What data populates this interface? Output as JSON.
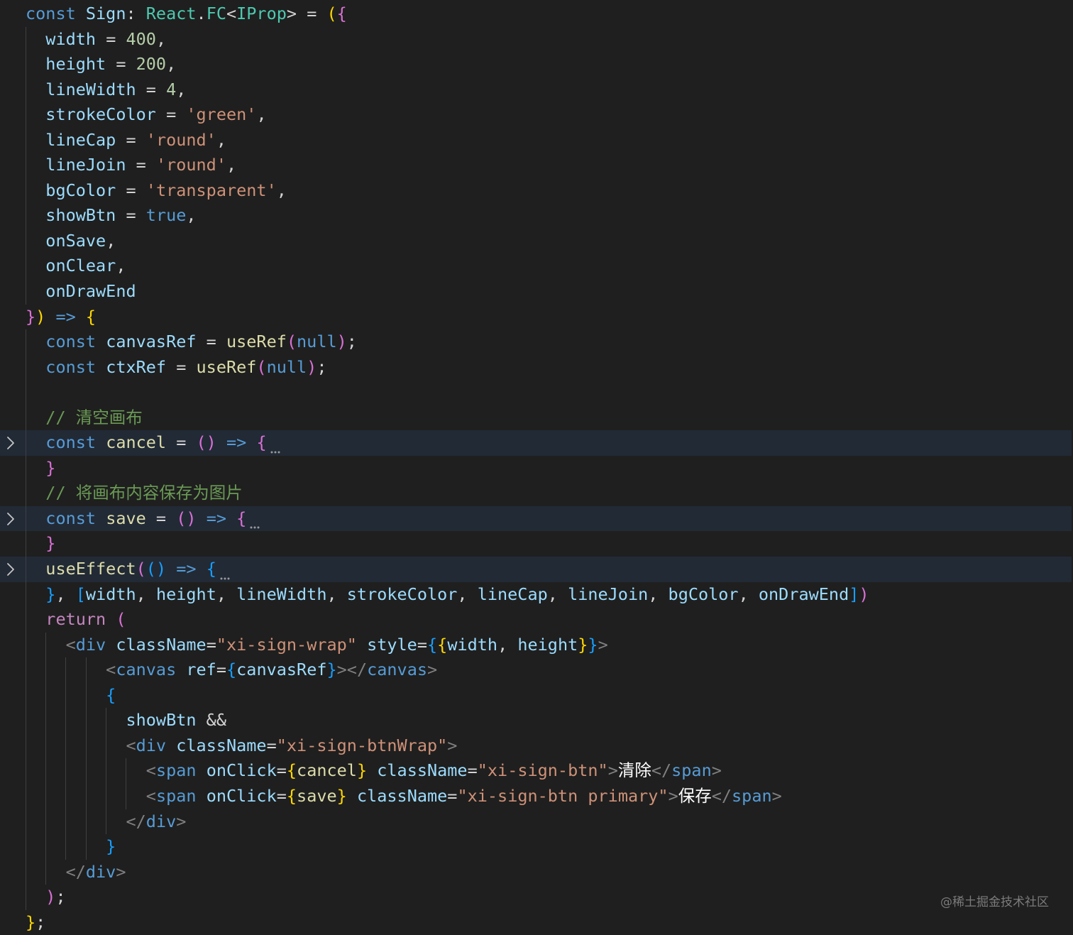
{
  "editor": {
    "lines": [
      {
        "tokens": [
          {
            "t": "const ",
            "c": "k"
          },
          {
            "t": "Sign",
            "c": "v"
          },
          {
            "t": ": ",
            "c": "op"
          },
          {
            "t": "React",
            "c": "t"
          },
          {
            "t": ".",
            "c": "op"
          },
          {
            "t": "FC",
            "c": "t"
          },
          {
            "t": "<",
            "c": "op"
          },
          {
            "t": "IProp",
            "c": "t"
          },
          {
            "t": ">",
            "c": "op"
          },
          {
            "t": " = ",
            "c": "op"
          },
          {
            "t": "(",
            "c": "p1"
          },
          {
            "t": "{",
            "c": "p2"
          }
        ]
      },
      {
        "guides": [
          36
        ],
        "tokens": [
          {
            "t": "  width",
            "c": "v"
          },
          {
            "t": " = ",
            "c": "op"
          },
          {
            "t": "400",
            "c": "n"
          },
          {
            "t": ",",
            "c": "op"
          }
        ]
      },
      {
        "guides": [
          36
        ],
        "tokens": [
          {
            "t": "  height",
            "c": "v"
          },
          {
            "t": " = ",
            "c": "op"
          },
          {
            "t": "200",
            "c": "n"
          },
          {
            "t": ",",
            "c": "op"
          }
        ]
      },
      {
        "guides": [
          36
        ],
        "tokens": [
          {
            "t": "  lineWidth",
            "c": "v"
          },
          {
            "t": " = ",
            "c": "op"
          },
          {
            "t": "4",
            "c": "n"
          },
          {
            "t": ",",
            "c": "op"
          }
        ]
      },
      {
        "guides": [
          36
        ],
        "tokens": [
          {
            "t": "  strokeColor",
            "c": "v"
          },
          {
            "t": " = ",
            "c": "op"
          },
          {
            "t": "'green'",
            "c": "s"
          },
          {
            "t": ",",
            "c": "op"
          }
        ]
      },
      {
        "guides": [
          36
        ],
        "tokens": [
          {
            "t": "  lineCap",
            "c": "v"
          },
          {
            "t": " = ",
            "c": "op"
          },
          {
            "t": "'round'",
            "c": "s"
          },
          {
            "t": ",",
            "c": "op"
          }
        ]
      },
      {
        "guides": [
          36
        ],
        "tokens": [
          {
            "t": "  lineJoin",
            "c": "v"
          },
          {
            "t": " = ",
            "c": "op"
          },
          {
            "t": "'round'",
            "c": "s"
          },
          {
            "t": ",",
            "c": "op"
          }
        ]
      },
      {
        "guides": [
          36
        ],
        "tokens": [
          {
            "t": "  bgColor",
            "c": "v"
          },
          {
            "t": " = ",
            "c": "op"
          },
          {
            "t": "'transparent'",
            "c": "s"
          },
          {
            "t": ",",
            "c": "op"
          }
        ]
      },
      {
        "guides": [
          36
        ],
        "tokens": [
          {
            "t": "  showBtn",
            "c": "v"
          },
          {
            "t": " = ",
            "c": "op"
          },
          {
            "t": "true",
            "c": "k"
          },
          {
            "t": ",",
            "c": "op"
          }
        ]
      },
      {
        "guides": [
          36
        ],
        "tokens": [
          {
            "t": "  onSave",
            "c": "v"
          },
          {
            "t": ",",
            "c": "op"
          }
        ]
      },
      {
        "guides": [
          36
        ],
        "tokens": [
          {
            "t": "  onClear",
            "c": "v"
          },
          {
            "t": ",",
            "c": "op"
          }
        ]
      },
      {
        "guides": [
          36
        ],
        "tokens": [
          {
            "t": "  onDrawEnd",
            "c": "v"
          }
        ]
      },
      {
        "tokens": [
          {
            "t": "}",
            "c": "p2"
          },
          {
            "t": ")",
            "c": "p1"
          },
          {
            "t": " ",
            "c": "op"
          },
          {
            "t": "=>",
            "c": "k"
          },
          {
            "t": " ",
            "c": "op"
          },
          {
            "t": "{",
            "c": "p1"
          }
        ]
      },
      {
        "guides": [
          36
        ],
        "tokens": [
          {
            "t": "  const ",
            "c": "k"
          },
          {
            "t": "canvasRef",
            "c": "v"
          },
          {
            "t": " = ",
            "c": "op"
          },
          {
            "t": "useRef",
            "c": "f"
          },
          {
            "t": "(",
            "c": "p2"
          },
          {
            "t": "null",
            "c": "k"
          },
          {
            "t": ")",
            "c": "p2"
          },
          {
            "t": ";",
            "c": "op"
          }
        ]
      },
      {
        "guides": [
          36
        ],
        "tokens": [
          {
            "t": "  const ",
            "c": "k"
          },
          {
            "t": "ctxRef",
            "c": "v"
          },
          {
            "t": " = ",
            "c": "op"
          },
          {
            "t": "useRef",
            "c": "f"
          },
          {
            "t": "(",
            "c": "p2"
          },
          {
            "t": "null",
            "c": "k"
          },
          {
            "t": ")",
            "c": "p2"
          },
          {
            "t": ";",
            "c": "op"
          }
        ]
      },
      {
        "guides": [
          36
        ],
        "tokens": []
      },
      {
        "guides": [
          36
        ],
        "tokens": [
          {
            "t": "  // ",
            "c": "c"
          },
          {
            "t": "清空画布",
            "c": "c cm-cjk"
          }
        ]
      },
      {
        "folded": true,
        "fold": true,
        "guides": [
          36
        ],
        "tokens": [
          {
            "t": "  const ",
            "c": "k"
          },
          {
            "t": "cancel",
            "c": "f"
          },
          {
            "t": " = ",
            "c": "op"
          },
          {
            "t": "()",
            "c": "p2"
          },
          {
            "t": " ",
            "c": "op"
          },
          {
            "t": "=>",
            "c": "k"
          },
          {
            "t": " ",
            "c": "op"
          },
          {
            "t": "{",
            "c": "p2"
          }
        ],
        "ellipsis": true
      },
      {
        "guides": [
          36
        ],
        "tokens": [
          {
            "t": "  }",
            "c": "p2"
          }
        ]
      },
      {
        "guides": [
          36
        ],
        "tokens": [
          {
            "t": "  // ",
            "c": "c"
          },
          {
            "t": "将画布内容保存为图片",
            "c": "c cm-cjk"
          }
        ]
      },
      {
        "folded": true,
        "fold": true,
        "guides": [
          36
        ],
        "tokens": [
          {
            "t": "  const ",
            "c": "k"
          },
          {
            "t": "save",
            "c": "f"
          },
          {
            "t": " = ",
            "c": "op"
          },
          {
            "t": "()",
            "c": "p2"
          },
          {
            "t": " ",
            "c": "op"
          },
          {
            "t": "=>",
            "c": "k"
          },
          {
            "t": " ",
            "c": "op"
          },
          {
            "t": "{",
            "c": "p2"
          }
        ],
        "ellipsis": true
      },
      {
        "guides": [
          36
        ],
        "tokens": [
          {
            "t": "  }",
            "c": "p2"
          }
        ]
      },
      {
        "folded": true,
        "fold": true,
        "guides": [
          36
        ],
        "tokens": [
          {
            "t": "  useEffect",
            "c": "f"
          },
          {
            "t": "(",
            "c": "p2"
          },
          {
            "t": "()",
            "c": "p3"
          },
          {
            "t": " ",
            "c": "op"
          },
          {
            "t": "=>",
            "c": "k"
          },
          {
            "t": " ",
            "c": "op"
          },
          {
            "t": "{",
            "c": "p3"
          }
        ],
        "ellipsis": true
      },
      {
        "guides": [
          36
        ],
        "tokens": [
          {
            "t": "  }",
            "c": "p3"
          },
          {
            "t": ", ",
            "c": "op"
          },
          {
            "t": "[",
            "c": "p3"
          },
          {
            "t": "width",
            "c": "v"
          },
          {
            "t": ", ",
            "c": "op"
          },
          {
            "t": "height",
            "c": "v"
          },
          {
            "t": ", ",
            "c": "op"
          },
          {
            "t": "lineWidth",
            "c": "v"
          },
          {
            "t": ", ",
            "c": "op"
          },
          {
            "t": "strokeColor",
            "c": "v"
          },
          {
            "t": ", ",
            "c": "op"
          },
          {
            "t": "lineCap",
            "c": "v"
          },
          {
            "t": ", ",
            "c": "op"
          },
          {
            "t": "lineJoin",
            "c": "v"
          },
          {
            "t": ", ",
            "c": "op"
          },
          {
            "t": "bgColor",
            "c": "v"
          },
          {
            "t": ", ",
            "c": "op"
          },
          {
            "t": "onDrawEnd",
            "c": "v"
          },
          {
            "t": "]",
            "c": "p3"
          },
          {
            "t": ")",
            "c": "p2"
          }
        ]
      },
      {
        "guides": [
          36
        ],
        "tokens": [
          {
            "t": "  return ",
            "c": "ret"
          },
          {
            "t": "(",
            "c": "p2"
          }
        ]
      },
      {
        "guides": [
          36,
          64
        ],
        "tokens": [
          {
            "t": "    <",
            "c": "br"
          },
          {
            "t": "div",
            "c": "tag"
          },
          {
            "t": " ",
            "c": "op"
          },
          {
            "t": "className",
            "c": "attr"
          },
          {
            "t": "=",
            "c": "op"
          },
          {
            "t": "\"xi-sign-wrap\"",
            "c": "s"
          },
          {
            "t": " ",
            "c": "op"
          },
          {
            "t": "style",
            "c": "attr"
          },
          {
            "t": "=",
            "c": "op"
          },
          {
            "t": "{",
            "c": "p3"
          },
          {
            "t": "{",
            "c": "p1"
          },
          {
            "t": "width",
            "c": "v"
          },
          {
            "t": ", ",
            "c": "op"
          },
          {
            "t": "height",
            "c": "v"
          },
          {
            "t": "}",
            "c": "p1"
          },
          {
            "t": "}",
            "c": "p3"
          },
          {
            "t": ">",
            "c": "br"
          }
        ]
      },
      {
        "guides": [
          36,
          64,
          92,
          121
        ],
        "tokens": [
          {
            "t": "        <",
            "c": "br"
          },
          {
            "t": "canvas",
            "c": "tag"
          },
          {
            "t": " ",
            "c": "op"
          },
          {
            "t": "ref",
            "c": "attr"
          },
          {
            "t": "=",
            "c": "op"
          },
          {
            "t": "{",
            "c": "p3"
          },
          {
            "t": "canvasRef",
            "c": "v"
          },
          {
            "t": "}",
            "c": "p3"
          },
          {
            "t": "></",
            "c": "br"
          },
          {
            "t": "canvas",
            "c": "tag"
          },
          {
            "t": ">",
            "c": "br"
          }
        ]
      },
      {
        "guides": [
          36,
          64,
          92,
          121
        ],
        "tokens": [
          {
            "t": "        {",
            "c": "p3"
          }
        ]
      },
      {
        "guides": [
          36,
          64,
          92,
          121,
          149
        ],
        "tokens": [
          {
            "t": "          showBtn",
            "c": "v"
          },
          {
            "t": " && ",
            "c": "op"
          }
        ]
      },
      {
        "guides": [
          36,
          64,
          92,
          121,
          149
        ],
        "tokens": [
          {
            "t": "          <",
            "c": "br"
          },
          {
            "t": "div",
            "c": "tag"
          },
          {
            "t": " ",
            "c": "op"
          },
          {
            "t": "className",
            "c": "attr"
          },
          {
            "t": "=",
            "c": "op"
          },
          {
            "t": "\"xi-sign-btnWrap\"",
            "c": "s"
          },
          {
            "t": ">",
            "c": "br"
          }
        ]
      },
      {
        "guides": [
          36,
          64,
          92,
          121,
          149,
          177
        ],
        "tokens": [
          {
            "t": "            <",
            "c": "br"
          },
          {
            "t": "span",
            "c": "tag"
          },
          {
            "t": " ",
            "c": "op"
          },
          {
            "t": "onClick",
            "c": "attr"
          },
          {
            "t": "=",
            "c": "op"
          },
          {
            "t": "{",
            "c": "p1"
          },
          {
            "t": "cancel",
            "c": "f"
          },
          {
            "t": "}",
            "c": "p1"
          },
          {
            "t": " ",
            "c": "op"
          },
          {
            "t": "className",
            "c": "attr"
          },
          {
            "t": "=",
            "c": "op"
          },
          {
            "t": "\"xi-sign-btn\"",
            "c": "s"
          },
          {
            "t": ">",
            "c": "br"
          },
          {
            "t": "清除",
            "c": "txt"
          },
          {
            "t": "</",
            "c": "br"
          },
          {
            "t": "span",
            "c": "tag"
          },
          {
            "t": ">",
            "c": "br"
          }
        ]
      },
      {
        "guides": [
          36,
          64,
          92,
          121,
          149,
          177
        ],
        "tokens": [
          {
            "t": "            <",
            "c": "br"
          },
          {
            "t": "span",
            "c": "tag"
          },
          {
            "t": " ",
            "c": "op"
          },
          {
            "t": "onClick",
            "c": "attr"
          },
          {
            "t": "=",
            "c": "op"
          },
          {
            "t": "{",
            "c": "p1"
          },
          {
            "t": "save",
            "c": "f"
          },
          {
            "t": "}",
            "c": "p1"
          },
          {
            "t": " ",
            "c": "op"
          },
          {
            "t": "className",
            "c": "attr"
          },
          {
            "t": "=",
            "c": "op"
          },
          {
            "t": "\"xi-sign-btn primary\"",
            "c": "s"
          },
          {
            "t": ">",
            "c": "br"
          },
          {
            "t": "保存",
            "c": "txt"
          },
          {
            "t": "</",
            "c": "br"
          },
          {
            "t": "span",
            "c": "tag"
          },
          {
            "t": ">",
            "c": "br"
          }
        ]
      },
      {
        "guides": [
          36,
          64,
          92,
          121,
          149
        ],
        "tokens": [
          {
            "t": "          </",
            "c": "br"
          },
          {
            "t": "div",
            "c": "tag"
          },
          {
            "t": ">",
            "c": "br"
          }
        ]
      },
      {
        "guides": [
          36,
          64,
          92,
          121
        ],
        "tokens": [
          {
            "t": "        }",
            "c": "p3"
          }
        ]
      },
      {
        "guides": [
          36,
          64
        ],
        "tokens": [
          {
            "t": "    </",
            "c": "br"
          },
          {
            "t": "div",
            "c": "tag"
          },
          {
            "t": ">",
            "c": "br"
          }
        ]
      },
      {
        "guides": [
          36
        ],
        "tokens": [
          {
            "t": "  )",
            "c": "p2"
          },
          {
            "t": ";",
            "c": "op"
          }
        ]
      },
      {
        "tokens": [
          {
            "t": "}",
            "c": "p1"
          },
          {
            "t": ";",
            "c": "op"
          }
        ]
      }
    ]
  },
  "watermark": "@稀土掘金技术社区",
  "colors": {
    "background": "#1f1f1f",
    "folded_line_highlight": "#222a36",
    "keyword": "#569cd6",
    "variable": "#9cdcfe",
    "function": "#dcdcaa",
    "type": "#4ec9b0",
    "string": "#ce9178",
    "number": "#b5cea8",
    "comment": "#6a9955",
    "control": "#c586c0",
    "bracket_1": "#ffd700",
    "bracket_2": "#da70d6",
    "bracket_3": "#179fff"
  },
  "icons": {
    "fold": "chevron-right-icon",
    "folded_ellipsis": "ellipsis-icon"
  }
}
